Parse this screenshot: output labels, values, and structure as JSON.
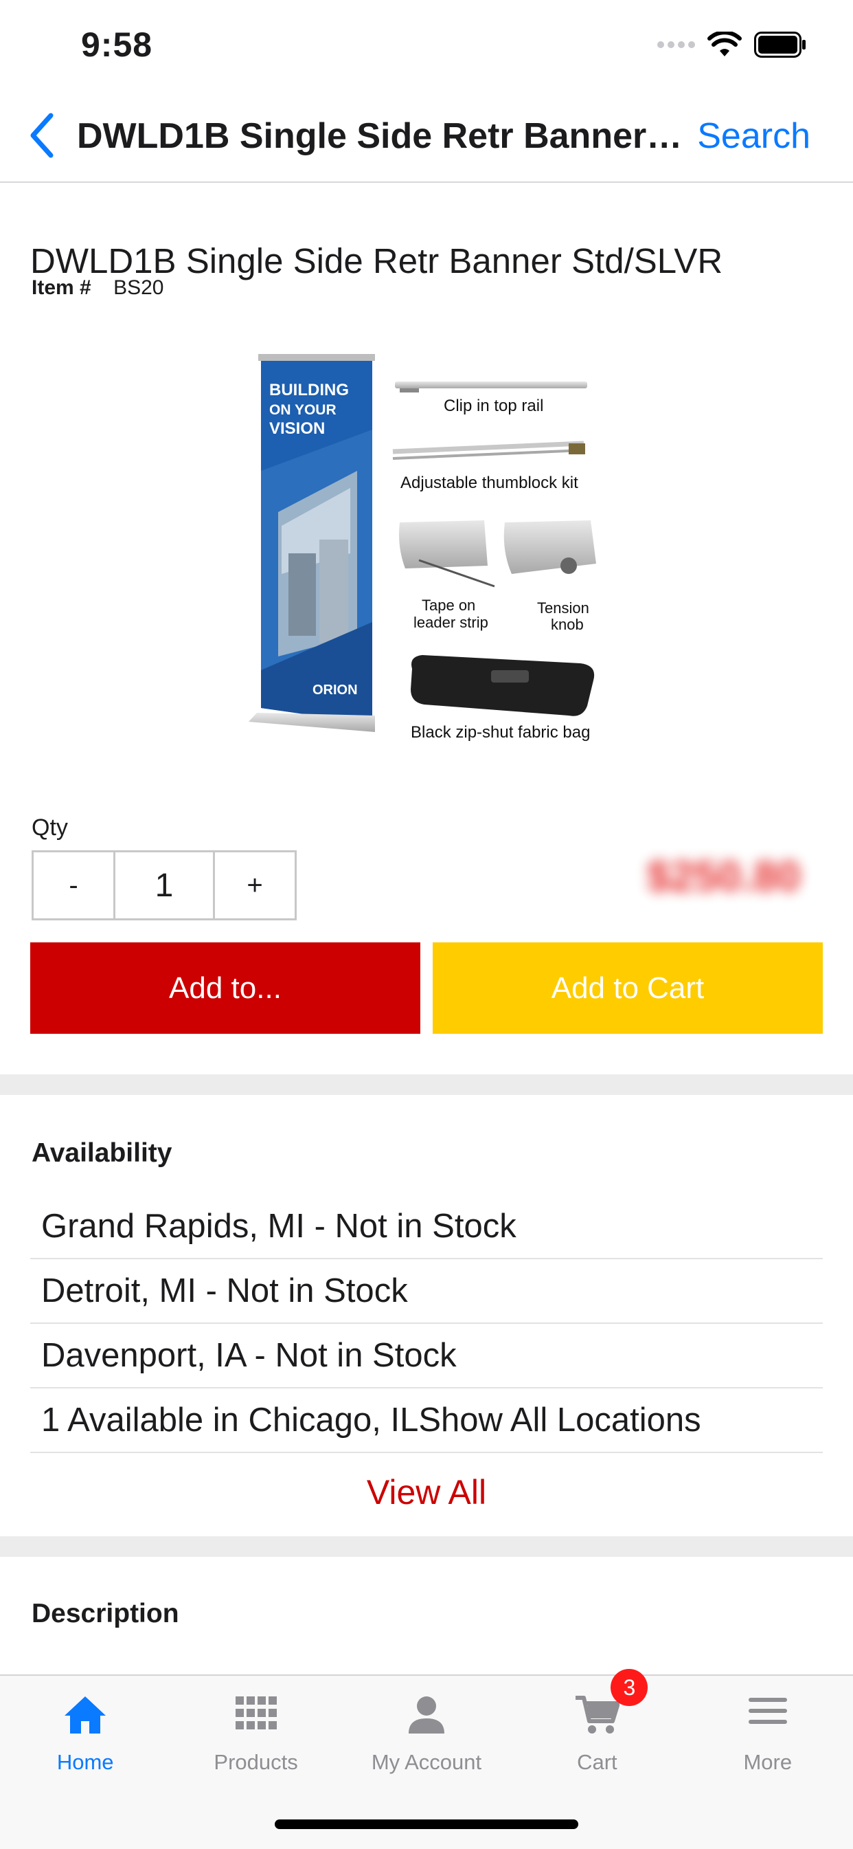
{
  "status_bar": {
    "time": "9:58"
  },
  "nav": {
    "title": "DWLD1B Single Side Retr Banner St...",
    "search_label": "Search"
  },
  "product": {
    "title": "DWLD1B Single Side Retr Banner Std/SLVR",
    "item_label": "Item #",
    "item_number": "BS20",
    "image": {
      "banner_text": [
        "BUILDING",
        "ON YOUR",
        "VISION"
      ],
      "brand": "ORION",
      "captions": [
        "Clip in top rail",
        "Adjustable thumblock kit",
        "Tape on",
        "leader strip",
        "Tension",
        "knob",
        "Black zip-shut fabric bag"
      ]
    }
  },
  "quantity": {
    "label": "Qty",
    "minus": "-",
    "value": "1",
    "plus": "+"
  },
  "price": "$250.80",
  "actions": {
    "add_to": "Add to...",
    "add_to_cart": "Add to Cart",
    "add_to_color": "#cc0000",
    "add_to_cart_color": "#ffcc00"
  },
  "availability": {
    "heading": "Availability",
    "locations": [
      "Grand Rapids, MI - Not in Stock",
      "Detroit, MI - Not in Stock",
      "Davenport, IA - Not in Stock",
      "1 Available in Chicago, ILShow All Locations"
    ],
    "view_all": "View All"
  },
  "description": {
    "heading": "Description"
  },
  "tab_bar": {
    "tabs": [
      {
        "label": "Home",
        "icon": "home-icon",
        "active": true
      },
      {
        "label": "Products",
        "icon": "grid-icon",
        "active": false
      },
      {
        "label": "My Account",
        "icon": "person-icon",
        "active": false
      },
      {
        "label": "Cart",
        "icon": "cart-icon",
        "active": false,
        "badge": "3"
      },
      {
        "label": "More",
        "icon": "menu-icon",
        "active": false
      }
    ],
    "active_color": "#0a7aff",
    "inactive_color": "#8e8e93"
  }
}
